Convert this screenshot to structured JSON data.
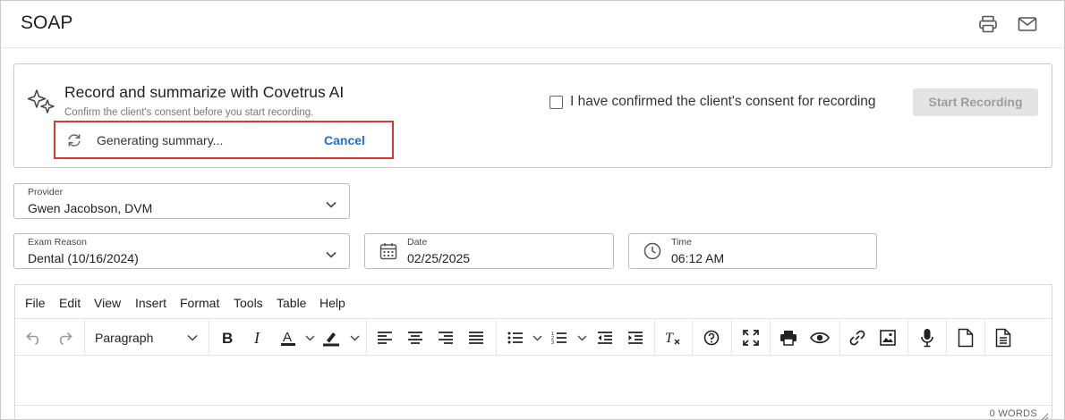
{
  "header": {
    "title": "SOAP",
    "print_icon": "printer-icon",
    "mail_icon": "mail-icon"
  },
  "ai_panel": {
    "title": "Record and summarize with Covetrus AI",
    "subtitle": "Confirm the client's consent before you start recording.",
    "sparkle_icon": "sparkle-icon",
    "status_text": "Generating summary...",
    "cancel_label": "Cancel",
    "consent_label": "I have confirmed the client's consent for recording",
    "consent_checked": false,
    "start_label": "Start Recording",
    "accent": "#1f6fd1",
    "highlight_color": "#d93636"
  },
  "form": {
    "provider": {
      "label": "Provider",
      "value": "Gwen Jacobson, DVM"
    },
    "exam_reason": {
      "label": "Exam Reason",
      "value": "Dental (10/16/2024)"
    },
    "date": {
      "label": "Date",
      "value": "02/25/2025"
    },
    "time": {
      "label": "Time",
      "value": "06:12 AM"
    }
  },
  "editor": {
    "menu": [
      "File",
      "Edit",
      "View",
      "Insert",
      "Format",
      "Tools",
      "Table",
      "Help"
    ],
    "block_format": "Paragraph",
    "word_count": "0 WORDS"
  }
}
